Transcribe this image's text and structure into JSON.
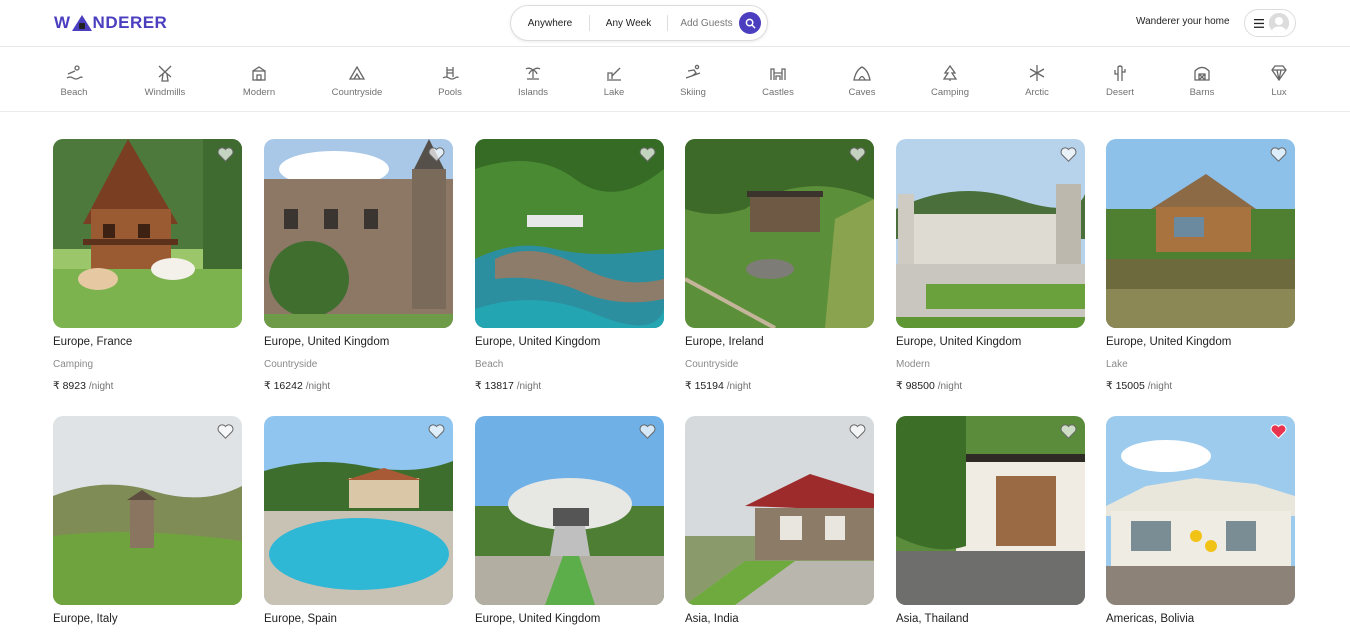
{
  "brand": {
    "name": "WANDERER",
    "name_part1": "W",
    "name_part2": "NDERER",
    "accent": "#4b3fc0"
  },
  "search": {
    "where": "Anywhere",
    "when": "Any Week",
    "guests": "Add Guests",
    "button_icon": "search-icon"
  },
  "header": {
    "host_link": "Wanderer your home",
    "menu_icon": "hamburger-icon",
    "avatar_icon": "user-avatar-icon"
  },
  "categories": [
    {
      "label": "Beach",
      "icon": "beach-icon"
    },
    {
      "label": "Windmills",
      "icon": "windmill-icon"
    },
    {
      "label": "Modern",
      "icon": "modern-icon"
    },
    {
      "label": "Countryside",
      "icon": "countryside-icon"
    },
    {
      "label": "Pools",
      "icon": "pool-icon"
    },
    {
      "label": "Islands",
      "icon": "island-icon"
    },
    {
      "label": "Lake",
      "icon": "lake-icon"
    },
    {
      "label": "Skiing",
      "icon": "skiing-icon"
    },
    {
      "label": "Castles",
      "icon": "castle-icon"
    },
    {
      "label": "Caves",
      "icon": "cave-icon"
    },
    {
      "label": "Camping",
      "icon": "camping-icon"
    },
    {
      "label": "Arctic",
      "icon": "snowflake-icon"
    },
    {
      "label": "Desert",
      "icon": "cactus-icon"
    },
    {
      "label": "Barns",
      "icon": "barn-icon"
    },
    {
      "label": "Lux",
      "icon": "diamond-icon"
    }
  ],
  "listings": [
    {
      "location": "Europe, France",
      "category": "Camping",
      "price": "₹ 8923",
      "per": "/night",
      "favorited": false,
      "scene": "chalet with horses"
    },
    {
      "location": "Europe, United Kingdom",
      "category": "Countryside",
      "price": "₹ 16242",
      "per": "/night",
      "favorited": false,
      "scene": "stone manor"
    },
    {
      "location": "Europe, United Kingdom",
      "category": "Beach",
      "price": "₹ 13817",
      "per": "/night",
      "favorited": false,
      "scene": "coastal cliffs"
    },
    {
      "location": "Europe, Ireland",
      "category": "Countryside",
      "price": "₹ 15194",
      "per": "/night",
      "favorited": false,
      "scene": "hillside cabin"
    },
    {
      "location": "Europe, United Kingdom",
      "category": "Modern",
      "price": "₹ 98500",
      "per": "/night",
      "favorited": false,
      "scene": "white castle"
    },
    {
      "location": "Europe, United Kingdom",
      "category": "Lake",
      "price": "₹ 15005",
      "per": "/night",
      "favorited": false,
      "scene": "modern house by pond"
    },
    {
      "location": "Europe, Italy",
      "favorited": false,
      "scene": "tower on hill"
    },
    {
      "location": "Europe, Spain",
      "favorited": false,
      "scene": "villa with pool"
    },
    {
      "location": "Europe, United Kingdom",
      "favorited": false,
      "scene": "ufo house"
    },
    {
      "location": "Asia, India",
      "favorited": false,
      "scene": "stone cottage"
    },
    {
      "location": "Asia, Thailand",
      "favorited": false,
      "scene": "garden house"
    },
    {
      "location": "Americas, Bolivia",
      "favorited": true,
      "scene": "tent lodge"
    }
  ],
  "colors": {
    "heart_active": "#e8344e",
    "heart_idle": "#ffffff"
  }
}
